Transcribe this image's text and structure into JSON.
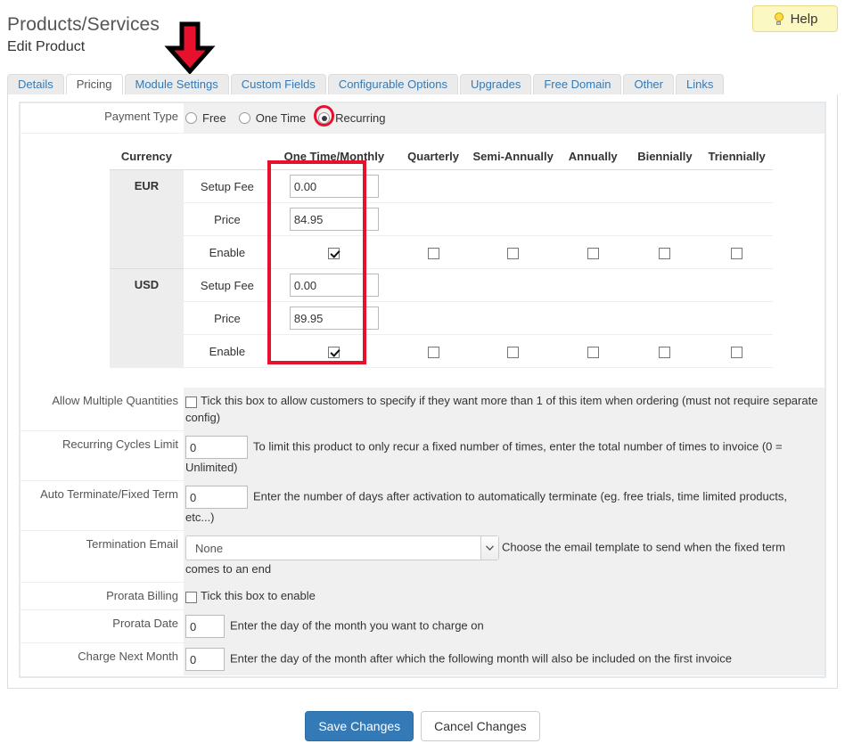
{
  "header": {
    "title": "Products/Services",
    "subtitle": "Edit Product",
    "help_label": "Help",
    "help_icon": "lightbulb-icon"
  },
  "tabs": [
    {
      "label": "Details",
      "active": false
    },
    {
      "label": "Pricing",
      "active": true
    },
    {
      "label": "Module Settings",
      "active": false
    },
    {
      "label": "Custom Fields",
      "active": false
    },
    {
      "label": "Configurable Options",
      "active": false
    },
    {
      "label": "Upgrades",
      "active": false
    },
    {
      "label": "Free Domain",
      "active": false
    },
    {
      "label": "Other",
      "active": false
    },
    {
      "label": "Links",
      "active": false
    }
  ],
  "annotations": {
    "arrow_color": "#e8112d",
    "arrow_outline": "#000000",
    "arrow_target": "Module Settings",
    "highlight_color": "#e8112d",
    "radio_circle_target": "Recurring",
    "column_box_target": "One Time/Monthly"
  },
  "payment_type": {
    "label": "Payment Type",
    "options": [
      {
        "label": "Free",
        "selected": false
      },
      {
        "label": "One Time",
        "selected": false
      },
      {
        "label": "Recurring",
        "selected": true
      }
    ]
  },
  "pricing_table": {
    "headers": [
      "Currency",
      "",
      "One Time/Monthly",
      "Quarterly",
      "Semi-Annually",
      "Annually",
      "Biennially",
      "Triennially"
    ],
    "row_labels": [
      "Setup Fee",
      "Price",
      "Enable"
    ],
    "currencies": [
      {
        "code": "EUR",
        "setup_fee": "0.00",
        "price": "84.95",
        "enabled": [
          true,
          false,
          false,
          false,
          false,
          false
        ]
      },
      {
        "code": "USD",
        "setup_fee": "0.00",
        "price": "89.95",
        "enabled": [
          true,
          false,
          false,
          false,
          false,
          false
        ]
      }
    ]
  },
  "fields": {
    "allow_multiple_quantities": {
      "label": "Allow Multiple Quantities",
      "checked": false,
      "help": "Tick this box to allow customers to specify if they want more than 1 of this item when ordering (must not require separate config)"
    },
    "recurring_cycles_limit": {
      "label": "Recurring Cycles Limit",
      "value": "0",
      "help": "To limit this product to only recur a fixed number of times, enter the total number of times to invoice (0 = Unlimited)"
    },
    "auto_terminate": {
      "label": "Auto Terminate/Fixed Term",
      "value": "0",
      "help": "Enter the number of days after activation to automatically terminate (eg. free trials, time limited products, etc...)"
    },
    "termination_email": {
      "label": "Termination Email",
      "value": "None",
      "help": "Choose the email template to send when the fixed term comes to an end"
    },
    "prorata_billing": {
      "label": "Prorata Billing",
      "checked": false,
      "help": "Tick this box to enable"
    },
    "prorata_date": {
      "label": "Prorata Date",
      "value": "0",
      "help": "Enter the day of the month you want to charge on"
    },
    "charge_next_month": {
      "label": "Charge Next Month",
      "value": "0",
      "help": "Enter the day of the month after which the following month will also be included on the first invoice"
    }
  },
  "footer": {
    "save_label": "Save Changes",
    "cancel_label": "Cancel Changes",
    "primary_color": "#337ab7"
  }
}
